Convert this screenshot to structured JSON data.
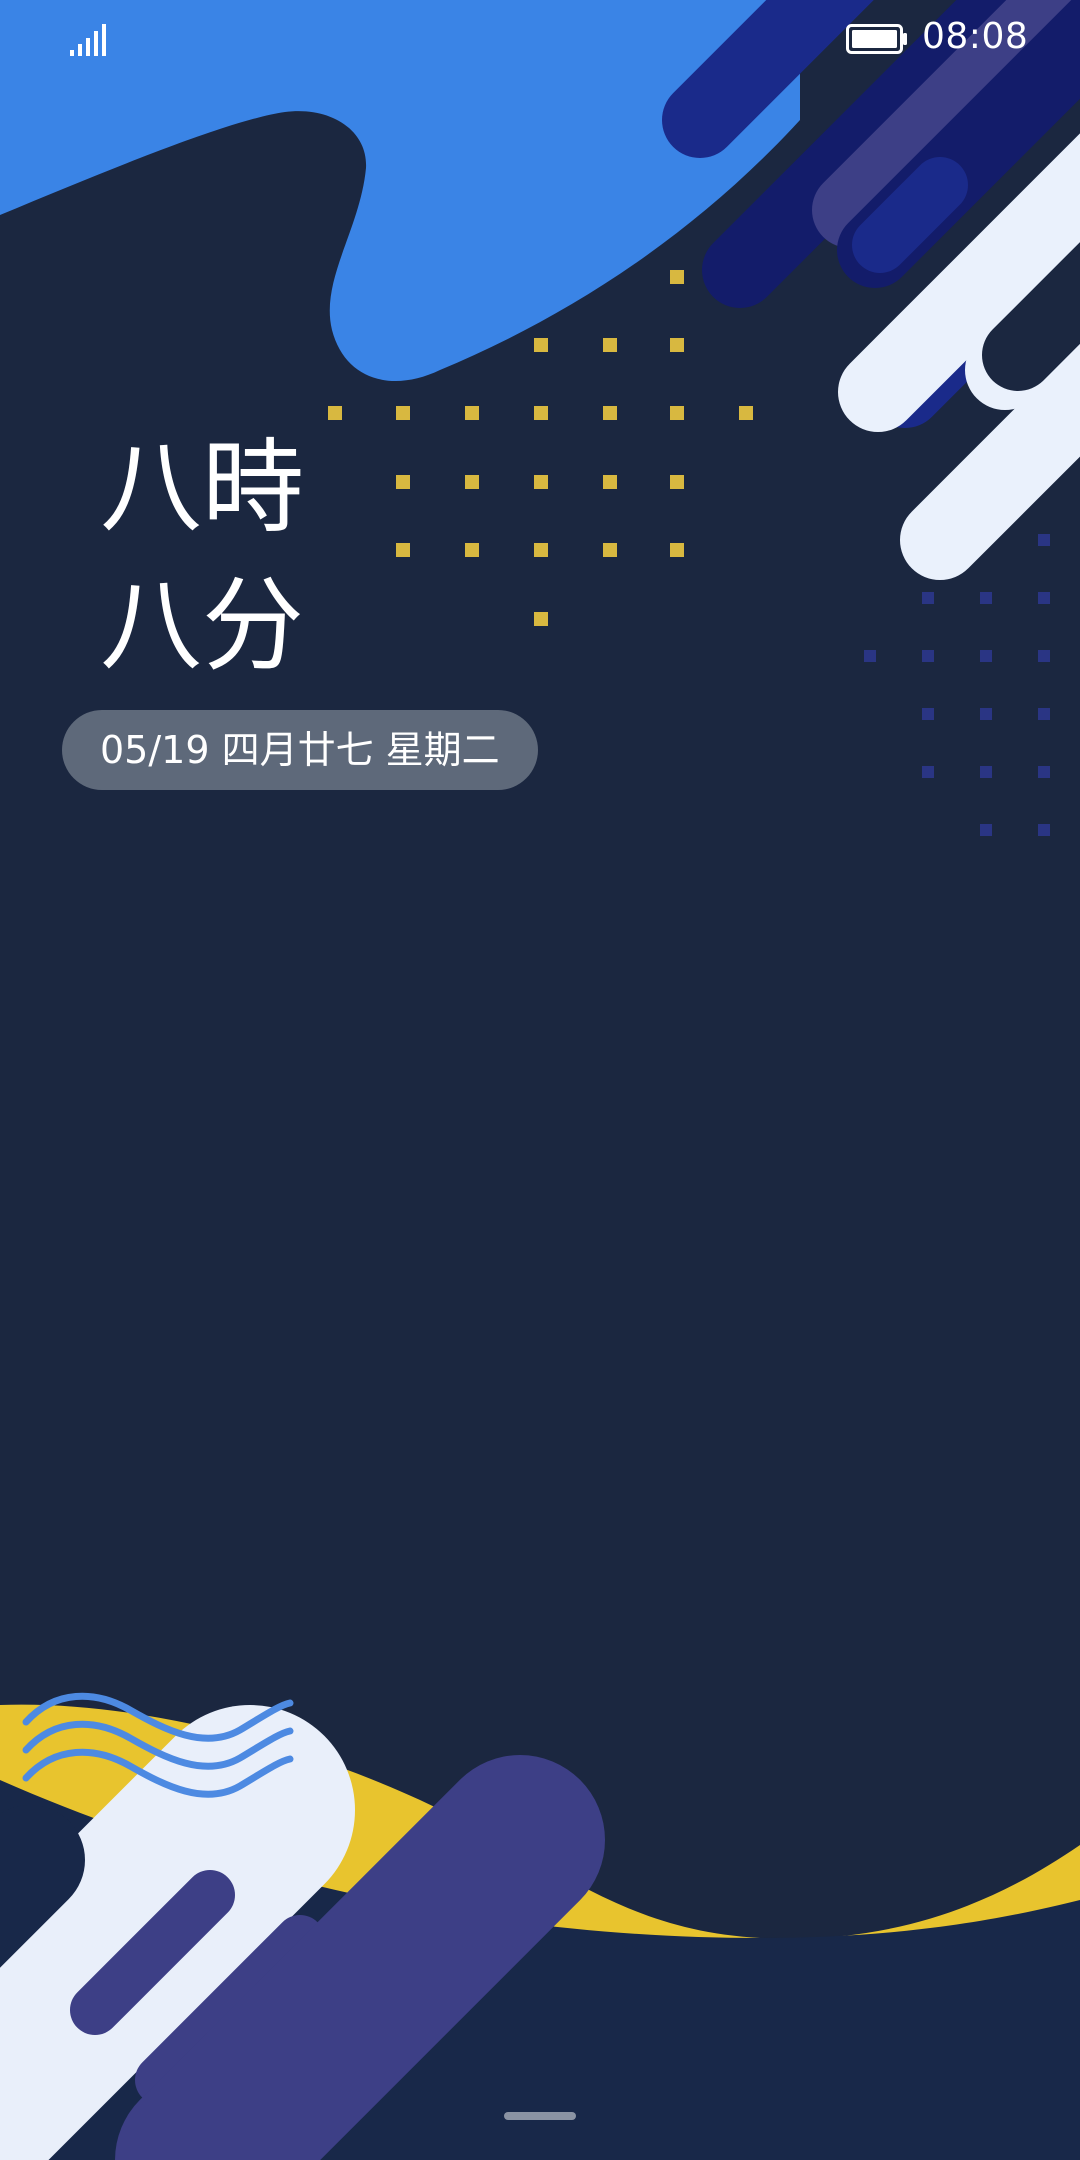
{
  "status_bar": {
    "time": "08:08",
    "signal_icon": "signal-bars-icon",
    "battery_icon": "battery-full-icon"
  },
  "clock": {
    "hour_text": "八時",
    "minute_text": "八分"
  },
  "date": {
    "label": "05/19 四月廿七 星期二"
  },
  "colors": {
    "background": "#1b2740",
    "blue_blob": "#3a84e6",
    "navy_stripe": "#1a2a8a",
    "purple_stripe": "#3d3f86",
    "white_stripe": "#eaf1fc",
    "yellow_wave": "#e8c42e",
    "dot_yellow": "#d8b840",
    "dot_navy": "#2a3584",
    "wave_lines": "#4d8ae2"
  }
}
